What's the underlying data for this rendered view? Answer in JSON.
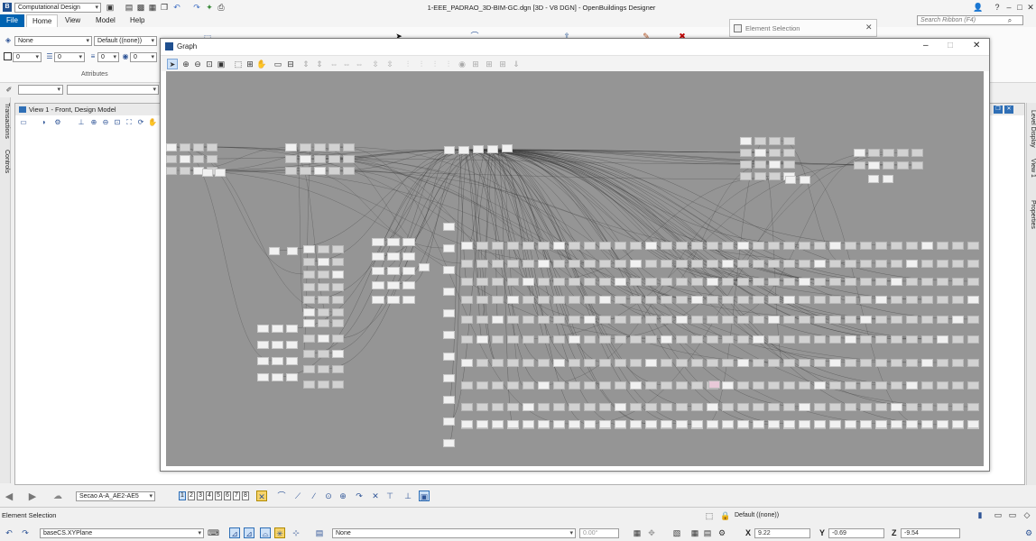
{
  "app": {
    "workflow": "Computational Design",
    "window_title": "1-EEE_PADRAO_3D-BIM-GC.dgn [3D - V8 DGN] - OpenBuildings Designer",
    "search_placeholder": "Search Ribbon (F4)"
  },
  "ribbon_tabs": [
    "File",
    "Home",
    "View",
    "Model",
    "Help"
  ],
  "attributes": {
    "level": "None",
    "color": "Default ((none))",
    "weight": "0",
    "style": "0",
    "transparency": "0",
    "priority": "0",
    "group_label": "Attributes"
  },
  "side_panels": {
    "left": [
      "Transactions",
      "Controls"
    ],
    "right": [
      "Level Display",
      "View 1",
      "Properties"
    ]
  },
  "view": {
    "title": "View 1 - Front, Design Model"
  },
  "element_selection_dialog": {
    "title": "Element Selection"
  },
  "graph_window": {
    "title": "Graph"
  },
  "status": {
    "tool_prompt": "Element Selection",
    "view_group": "Secao A-A_AE2-AE5",
    "view_numbers": [
      "1",
      "2",
      "3",
      "4",
      "5",
      "6",
      "7",
      "8"
    ],
    "accudraw_plane": "baseCS.XYPlane",
    "active_level": "Default ((none))",
    "snap_mode": "None",
    "angle": "0.00°",
    "x_label": "X",
    "x": "9.22",
    "y_label": "Y",
    "y": "-0.69",
    "z_label": "Z",
    "z": "-9.54"
  }
}
